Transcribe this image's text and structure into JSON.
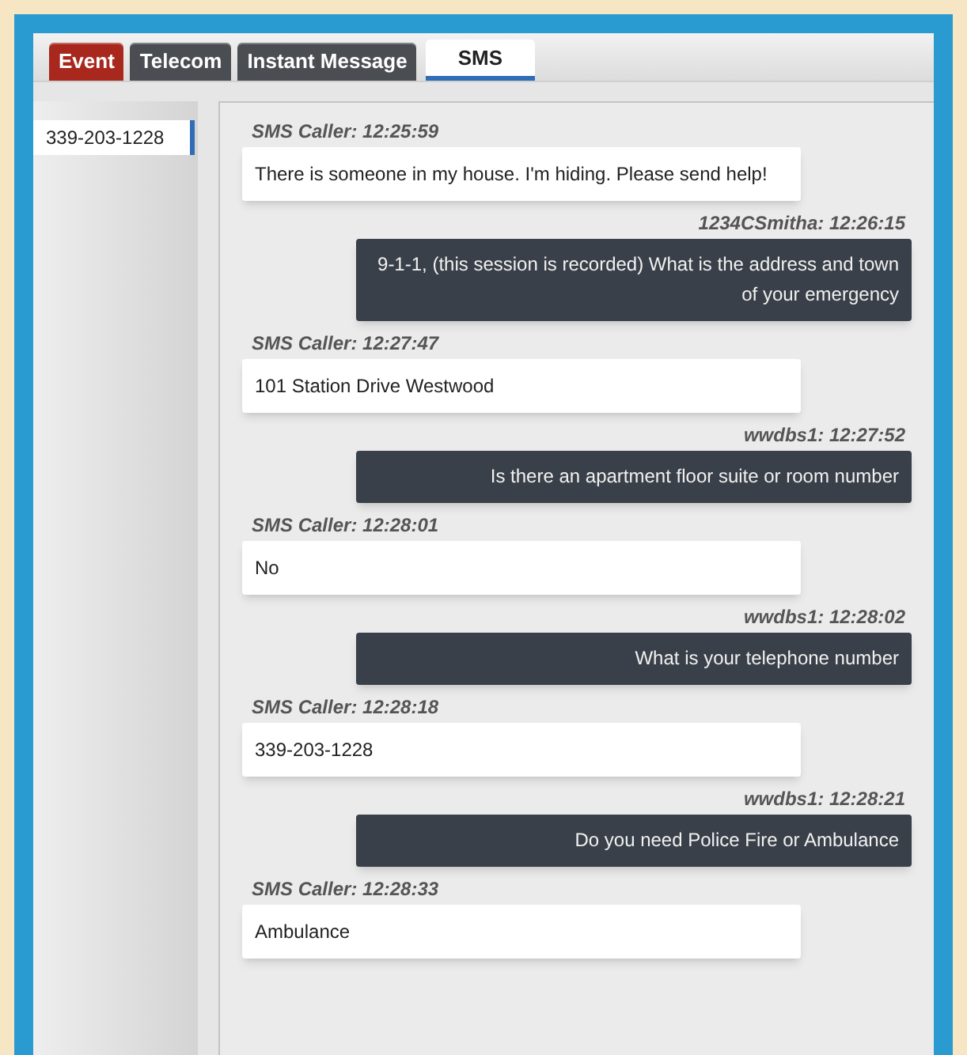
{
  "tabs": [
    {
      "label": "Event",
      "selected": false,
      "color": "#a8281e"
    },
    {
      "label": "Telecom",
      "selected": false,
      "color": "#4a4d52"
    },
    {
      "label": "Instant Message",
      "selected": false,
      "color": "#4a4d52"
    },
    {
      "label": "SMS",
      "selected": true,
      "color": "#ffffff"
    }
  ],
  "sessions": [
    {
      "label": "339-203-1228",
      "selected": true
    }
  ],
  "messages": [
    {
      "kind": "incoming",
      "header": "SMS Caller: 12:25:59",
      "text": "There is someone in my house. I'm hiding. Please send help!"
    },
    {
      "kind": "outgoing",
      "header": "1234CSmitha: 12:26:15",
      "text": "9-1-1, (this session is recorded) What is the address and town of your emergency"
    },
    {
      "kind": "incoming",
      "header": "SMS Caller: 12:27:47",
      "text": "101 Station Drive Westwood"
    },
    {
      "kind": "outgoing",
      "header": "wwdbs1: 12:27:52",
      "text": "Is there an apartment floor suite or room number"
    },
    {
      "kind": "incoming",
      "header": "SMS Caller: 12:28:01",
      "text": "No"
    },
    {
      "kind": "outgoing",
      "header": "wwdbs1: 12:28:02",
      "text": "What is your telephone number"
    },
    {
      "kind": "incoming",
      "header": "SMS Caller: 12:28:18",
      "text": "339-203-1228"
    },
    {
      "kind": "outgoing",
      "header": "wwdbs1: 12:28:21",
      "text": "Do you need Police Fire or Ambulance"
    },
    {
      "kind": "incoming",
      "header": "SMS Caller: 12:28:33",
      "text": "Ambulance"
    }
  ]
}
